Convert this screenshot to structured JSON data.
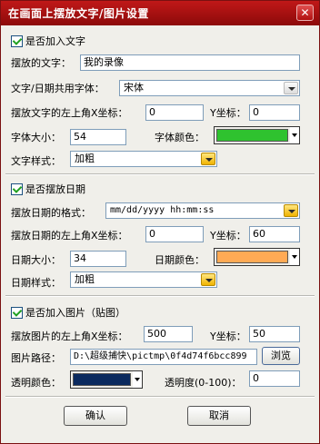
{
  "window": {
    "title": "在画面上摆放文字/图片设置",
    "close_glyph": "✕"
  },
  "text_section": {
    "enable_label": "是否加入文字",
    "text_label": "摆放的文字：",
    "text_value": "我的录像",
    "font_label": "文字/日期共用字体：",
    "font_value": "宋体",
    "x_label": "摆放文字的左上角X坐标：",
    "x_value": "0",
    "y_label": "Y坐标：",
    "y_value": "0",
    "size_label": "字体大小：",
    "size_value": "54",
    "color_label": "字体颜色：",
    "color_hex": "#2fc22f",
    "style_label": "文字样式：",
    "style_value": "加粗"
  },
  "date_section": {
    "enable_label": "是否摆放日期",
    "format_label": "摆放日期的格式：",
    "format_value": "mm/dd/yyyy hh:mm:ss",
    "x_label": "摆放日期的左上角X坐标：",
    "x_value": "0",
    "y_label": "Y坐标：",
    "y_value": "60",
    "size_label": "日期大小：",
    "size_value": "34",
    "color_label": "日期颜色：",
    "color_hex": "#ffaa55",
    "style_label": "日期样式：",
    "style_value": "加粗"
  },
  "image_section": {
    "enable_label": "是否加入图片（贴图）",
    "x_label": "摆放图片的左上角X坐标：",
    "x_value": "500",
    "y_label": "Y坐标：",
    "y_value": "50",
    "path_label": "图片路径：",
    "path_value": "D:\\超级捕快\\pictmp\\0f4d74f6bcc899",
    "browse_label": "浏览",
    "transparent_color_label": "透明颜色：",
    "transparent_color_hex": "#0b2a5e",
    "opacity_label": "透明度(0-100)：",
    "opacity_value": "0"
  },
  "buttons": {
    "ok_label": "确认",
    "cancel_label": "取消"
  }
}
